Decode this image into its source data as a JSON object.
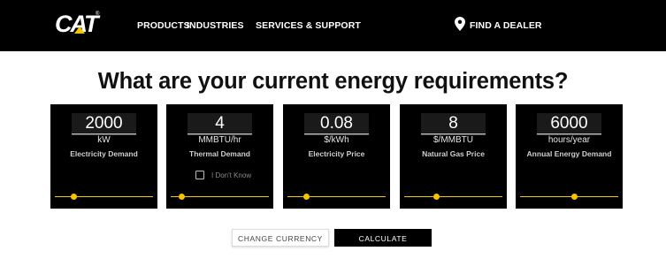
{
  "header": {
    "logo_text": "CAT",
    "logo_reg": "®",
    "nav": [
      "PRODUCTS",
      "INDUSTRIES",
      "SERVICES & SUPPORT"
    ],
    "dealer_label": "FIND A DEALER",
    "dealer_icon": "map-pin-icon"
  },
  "main": {
    "title": "What are your current energy requirements?"
  },
  "cards": [
    {
      "value": "2000",
      "unit": "kW",
      "caption": "Electricity Demand",
      "slider_fraction": 0.19
    },
    {
      "value": "4",
      "unit": "MMBTU/hr",
      "caption": "Thermal Demand",
      "slider_fraction": 0.11,
      "checkbox_label": "I Don't Know"
    },
    {
      "value": "0.08",
      "unit": "$/kWh",
      "caption": "Electricity Price",
      "slider_fraction": 0.19
    },
    {
      "value": "8",
      "unit": "$/MMBTU",
      "caption": "Natural Gas Price",
      "slider_fraction": 0.32
    },
    {
      "value": "6000",
      "unit": "hours/year",
      "caption": "Annual Energy Demand",
      "slider_fraction": 0.55
    }
  ],
  "buttons": {
    "change_currency": "CHANGE CURRENCY",
    "calculate": "CALCULATE"
  },
  "colors": {
    "accent": "#f5c400",
    "header_bg": "#000000",
    "card_bg": "#000000"
  }
}
